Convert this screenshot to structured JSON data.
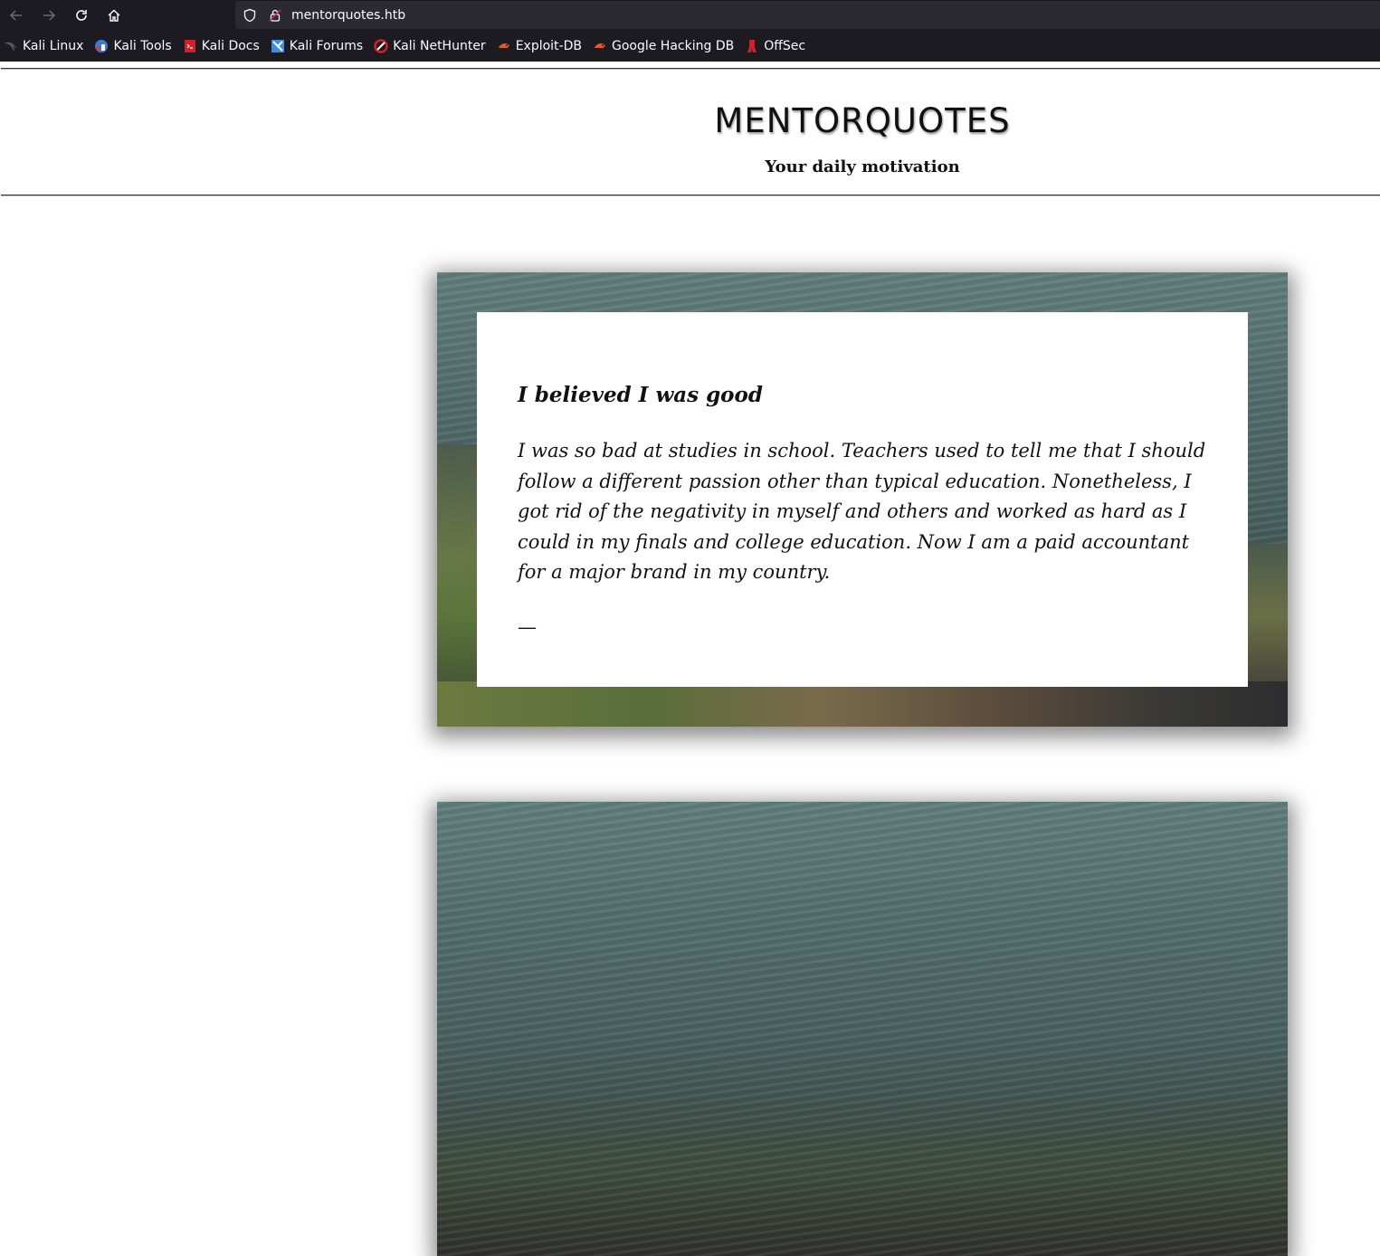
{
  "browser": {
    "url": "mentorquotes.htb",
    "bookmarks": [
      {
        "label": "Kali Linux",
        "icon": "kali-dragon-icon",
        "color": "#000000"
      },
      {
        "label": "Kali Tools",
        "icon": "kali-tools-icon",
        "color": "#3a7bd5"
      },
      {
        "label": "Kali Docs",
        "icon": "kali-docs-icon",
        "color": "#d0202a"
      },
      {
        "label": "Kali Forums",
        "icon": "kali-forums-icon",
        "color": "#3a8ee6"
      },
      {
        "label": "Kali NetHunter",
        "icon": "kali-nethunter-icon",
        "color": "#d0202a"
      },
      {
        "label": "Exploit-DB",
        "icon": "exploit-db-icon",
        "color": "#e2582a"
      },
      {
        "label": "Google Hacking DB",
        "icon": "google-hacking-db-icon",
        "color": "#e2582a"
      },
      {
        "label": "OffSec",
        "icon": "offsec-icon",
        "color": "#d0202a"
      }
    ]
  },
  "header": {
    "title": "MENTORQUOTES",
    "tagline": "Your daily motivation"
  },
  "quotes": [
    {
      "title": "I believed I was good",
      "text": "I was so bad at studies in school. Teachers used to tell me that I should follow a different passion other than typical education. Nonetheless, I got rid of the negativity in myself and others and worked as hard as I could in my finals and college education. Now I am a paid accountant for a major brand in my country.",
      "author": "—"
    }
  ]
}
